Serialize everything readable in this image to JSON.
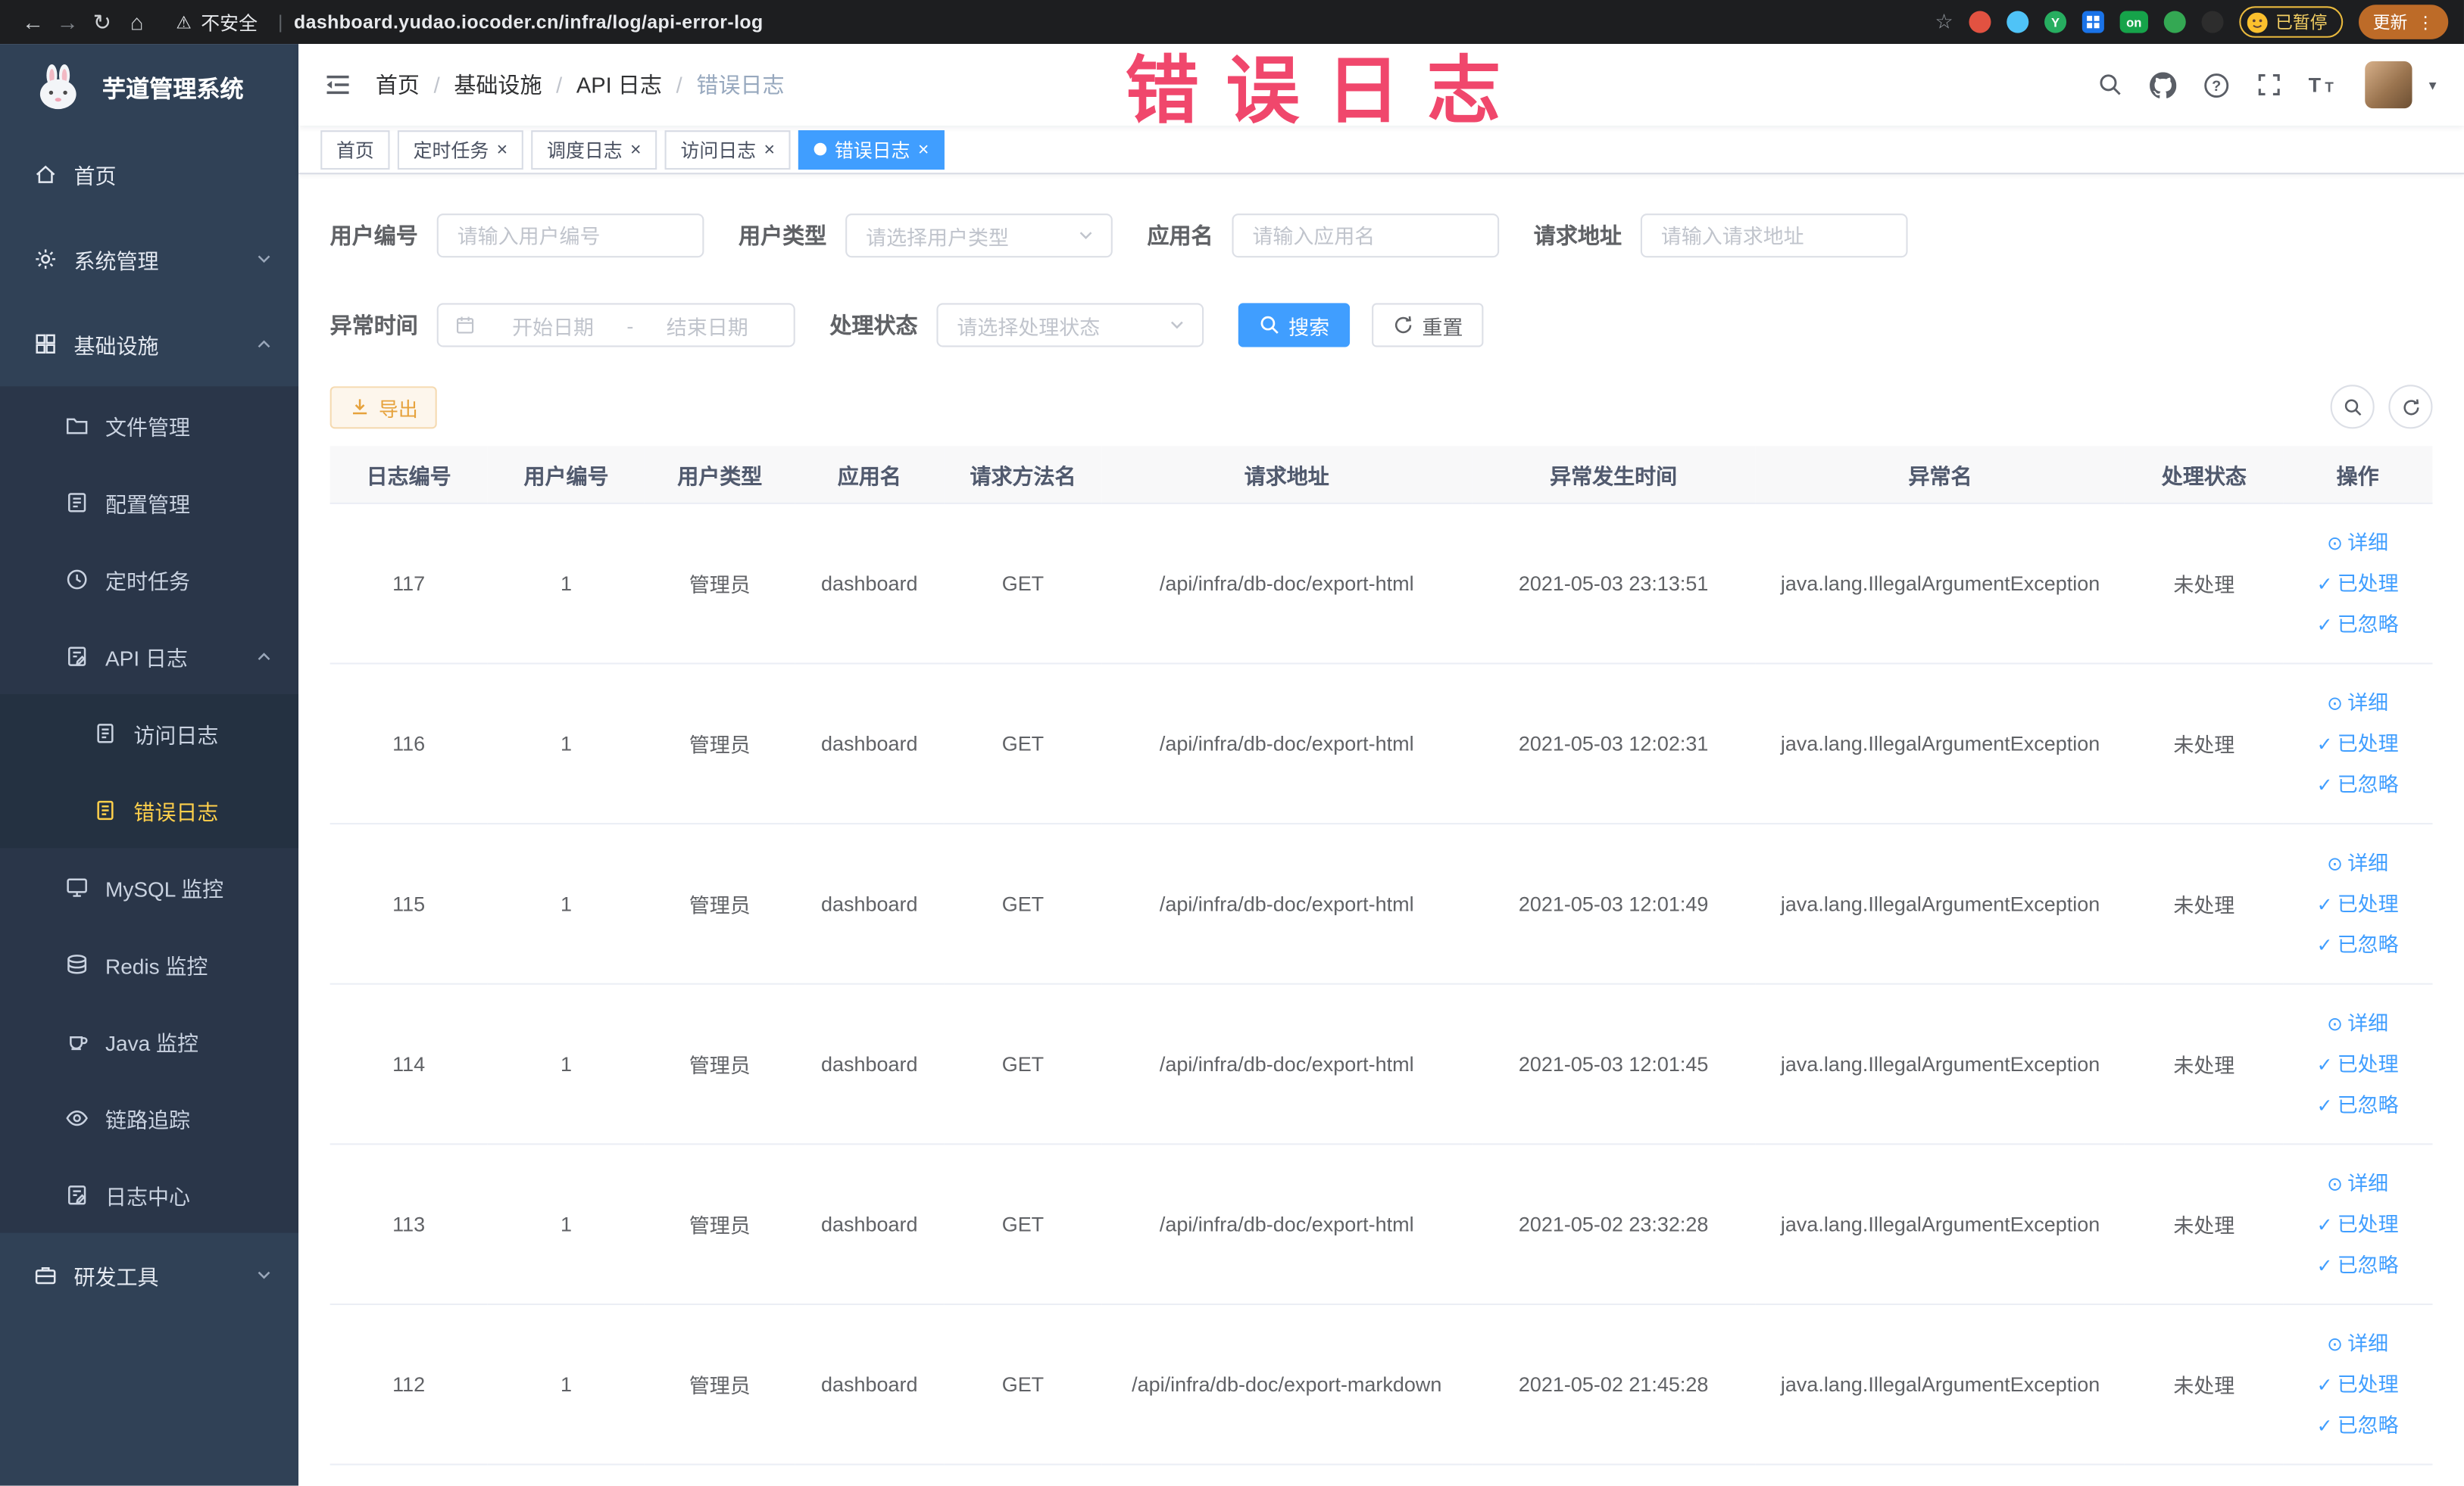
{
  "browser": {
    "security_label": "不安全",
    "url": "dashboard.yudao.iocoder.cn/infra/log/api-error-log",
    "extension_badge": "on",
    "extension_y": "Y",
    "paused_badge": "已暂停",
    "update_button": "更新"
  },
  "icons": {
    "back": "←",
    "forward": "→",
    "reload": "↻",
    "home": "⌂",
    "warning": "⚠",
    "separator": "|",
    "star": "☆",
    "more": "⋮",
    "caret": "▼",
    "close": "×",
    "check": "✓",
    "view": "⊙"
  },
  "annotation": {
    "text": "错误日志"
  },
  "sidebar": {
    "logo_title": "芋道管理系统",
    "items": [
      {
        "label": "首页"
      },
      {
        "label": "系统管理"
      },
      {
        "label": "基础设施"
      },
      {
        "label": "文件管理"
      },
      {
        "label": "配置管理"
      },
      {
        "label": "定时任务"
      },
      {
        "label": "API 日志"
      },
      {
        "label": "访问日志"
      },
      {
        "label": "错误日志"
      },
      {
        "label": "MySQL 监控"
      },
      {
        "label": "Redis 监控"
      },
      {
        "label": "Java 监控"
      },
      {
        "label": "链路追踪"
      },
      {
        "label": "日志中心"
      },
      {
        "label": "研发工具"
      }
    ]
  },
  "navbar": {
    "breadcrumbs": [
      "首页",
      "基础设施",
      "API 日志",
      "错误日志"
    ],
    "breadcrumb_separator": "/"
  },
  "tabs": [
    {
      "label": "首页"
    },
    {
      "label": "定时任务"
    },
    {
      "label": "调度日志"
    },
    {
      "label": "访问日志"
    },
    {
      "label": "错误日志"
    }
  ],
  "filters": {
    "user_id_label": "用户编号",
    "user_id_placeholder": "请输入用户编号",
    "user_type_label": "用户类型",
    "user_type_placeholder": "请选择用户类型",
    "app_name_label": "应用名",
    "app_name_placeholder": "请输入应用名",
    "request_url_label": "请求地址",
    "request_url_placeholder": "请输入请求地址",
    "exception_time_label": "异常时间",
    "date_start_placeholder": "开始日期",
    "date_separator": "-",
    "date_end_placeholder": "结束日期",
    "process_status_label": "处理状态",
    "process_status_placeholder": "请选择处理状态",
    "search_button": "搜索",
    "reset_button": "重置"
  },
  "toolbar": {
    "export_button": "导出"
  },
  "table": {
    "columns": [
      "日志编号",
      "用户编号",
      "用户类型",
      "应用名",
      "请求方法名",
      "请求地址",
      "异常发生时间",
      "异常名",
      "处理状态",
      "操作"
    ],
    "action_labels": [
      "详细",
      "已处理",
      "已忽略"
    ],
    "rows": [
      {
        "id": "117",
        "user_id": "1",
        "user_type": "管理员",
        "app_name": "dashboard",
        "method": "GET",
        "url": "/api/infra/db-doc/export-html",
        "time": "2021-05-03 23:13:51",
        "exception": "java.lang.IllegalArgumentException",
        "status": "未处理"
      },
      {
        "id": "116",
        "user_id": "1",
        "user_type": "管理员",
        "app_name": "dashboard",
        "method": "GET",
        "url": "/api/infra/db-doc/export-html",
        "time": "2021-05-03 12:02:31",
        "exception": "java.lang.IllegalArgumentException",
        "status": "未处理"
      },
      {
        "id": "115",
        "user_id": "1",
        "user_type": "管理员",
        "app_name": "dashboard",
        "method": "GET",
        "url": "/api/infra/db-doc/export-html",
        "time": "2021-05-03 12:01:49",
        "exception": "java.lang.IllegalArgumentException",
        "status": "未处理"
      },
      {
        "id": "114",
        "user_id": "1",
        "user_type": "管理员",
        "app_name": "dashboard",
        "method": "GET",
        "url": "/api/infra/db-doc/export-html",
        "time": "2021-05-03 12:01:45",
        "exception": "java.lang.IllegalArgumentException",
        "status": "未处理"
      },
      {
        "id": "113",
        "user_id": "1",
        "user_type": "管理员",
        "app_name": "dashboard",
        "method": "GET",
        "url": "/api/infra/db-doc/export-html",
        "time": "2021-05-02 23:32:28",
        "exception": "java.lang.IllegalArgumentException",
        "status": "未处理"
      },
      {
        "id": "112",
        "user_id": "1",
        "user_type": "管理员",
        "app_name": "dashboard",
        "method": "GET",
        "url": "/api/infra/db-doc/export-markdown",
        "time": "2021-05-02 21:45:28",
        "exception": "java.lang.IllegalArgumentException",
        "status": "未处理"
      }
    ]
  }
}
